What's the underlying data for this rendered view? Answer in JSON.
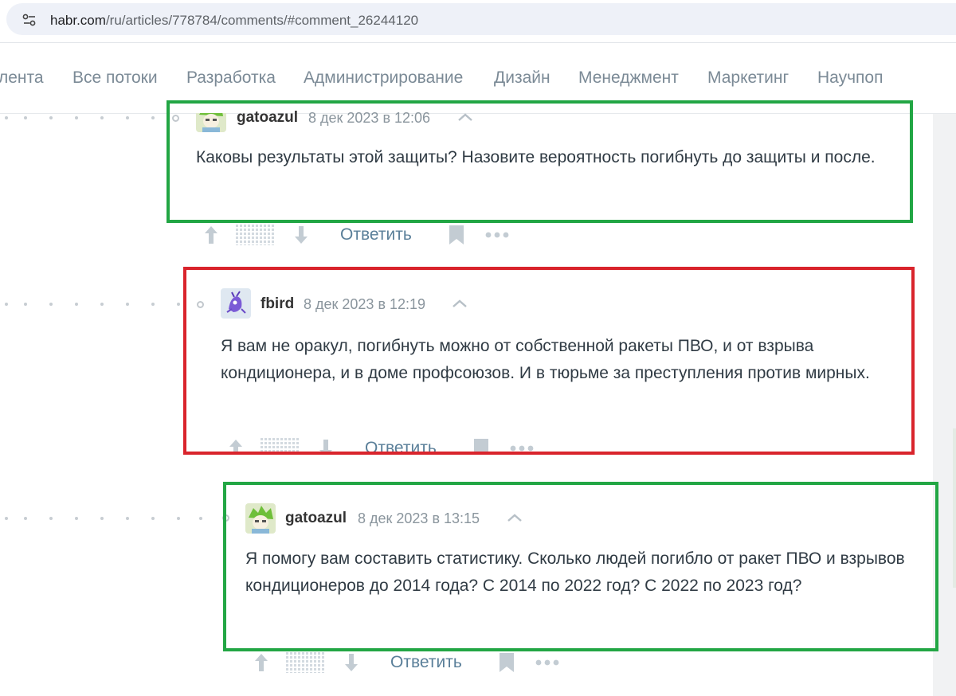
{
  "browser": {
    "url_host": "habr.com",
    "url_path": "/ru/articles/778784/comments/#comment_26244120"
  },
  "nav": {
    "items": [
      "лента",
      "Все потоки",
      "Разработка",
      "Администрирование",
      "Дизайн",
      "Менеджмент",
      "Маркетинг",
      "Научпоп"
    ]
  },
  "comments": [
    {
      "author": "gatoazul",
      "time": "8 дек 2023 в 12:06",
      "text": "Каковы результаты этой защиты? Назовите вероятность погибнуть до защиты и после.",
      "reply_label": "Ответить",
      "highlight": "#22a644"
    },
    {
      "author": "fbird",
      "time": "8 дек 2023 в 12:19",
      "text": "Я вам не оракул, погибнуть можно от собственной ракеты ПВО, и от взрыва кондиционера, и в доме профсоюзов. И в тюрьме за преступления против мирных.",
      "reply_label": "Ответить",
      "highlight": "#d9242c"
    },
    {
      "author": "gatoazul",
      "time": "8 дек 2023 в 13:15",
      "text": "Я помогу вам составить статистику. Сколько людей погибло от ракет ПВО и взрывов кондиционеров до 2014 года? С 2014 по 2022 год? С 2022 по 2023 год?",
      "reply_label": "Ответить",
      "highlight": "#22a644"
    }
  ],
  "icons": {
    "site_info": "site-info-icon",
    "upvote": "arrow-up-icon",
    "score": "score-hidden-icon",
    "downvote": "arrow-down-icon",
    "bookmark": "bookmark-icon",
    "more": "more-icon",
    "collapse": "chevron-up-icon"
  }
}
